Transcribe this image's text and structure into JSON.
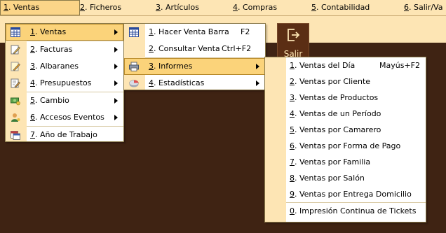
{
  "menubar": {
    "items": [
      {
        "num": "1",
        "rest": ". Ventas"
      },
      {
        "num": "2",
        "rest": ". Ficheros"
      },
      {
        "num": "3",
        "rest": ". Artículos"
      },
      {
        "num": "4",
        "rest": ". Compras"
      },
      {
        "num": "5",
        "rest": ". Contabilidad"
      },
      {
        "num": "6",
        "rest": ". Salir/Va"
      }
    ]
  },
  "toolbar": {
    "salir_label": "Salir"
  },
  "menu_ventas": {
    "items": [
      {
        "num": "1",
        "rest": ". Ventas"
      },
      {
        "num": "2",
        "rest": ". Facturas"
      },
      {
        "num": "3",
        "rest": ". Albaranes"
      },
      {
        "num": "4",
        "rest": ". Presupuestos"
      },
      {
        "num": "5",
        "rest": ". Cambio"
      },
      {
        "num": "6",
        "rest": ". Accesos Eventos"
      },
      {
        "num": "7",
        "rest": ". Año de Trabajo"
      }
    ]
  },
  "menu_sub_ventas": {
    "items": [
      {
        "num": "1",
        "rest": ". Hacer Venta Barra",
        "shortcut": "F2"
      },
      {
        "num": "2",
        "rest": ". Consultar Venta",
        "shortcut": "Ctrl+F2"
      },
      {
        "num": "3",
        "rest": ". Informes",
        "shortcut": ""
      },
      {
        "num": "4",
        "rest": ". Estadísticas",
        "shortcut": ""
      }
    ]
  },
  "menu_informes": {
    "items": [
      {
        "num": "1",
        "rest": ". Ventas del Día",
        "shortcut": "Mayús+F2"
      },
      {
        "num": "2",
        "rest": ". Ventas por Cliente"
      },
      {
        "num": "3",
        "rest": ". Ventas de Productos"
      },
      {
        "num": "4",
        "rest": ". Ventas de un Período"
      },
      {
        "num": "5",
        "rest": ". Ventas por Camarero"
      },
      {
        "num": "6",
        "rest": ". Ventas por Forma de Pago"
      },
      {
        "num": "7",
        "rest": ". Ventas por Familia"
      },
      {
        "num": "8",
        "rest": ". Ventas por Salón"
      },
      {
        "num": "9",
        "rest": ". Ventas por Entrega Domicilio"
      },
      {
        "num": "0",
        "rest": ". Impresión Continua de Tickets"
      }
    ]
  },
  "colors": {
    "menubar_bg": "#fde5b4",
    "highlight": "#fbd37a",
    "desktop": "#3f2313"
  }
}
